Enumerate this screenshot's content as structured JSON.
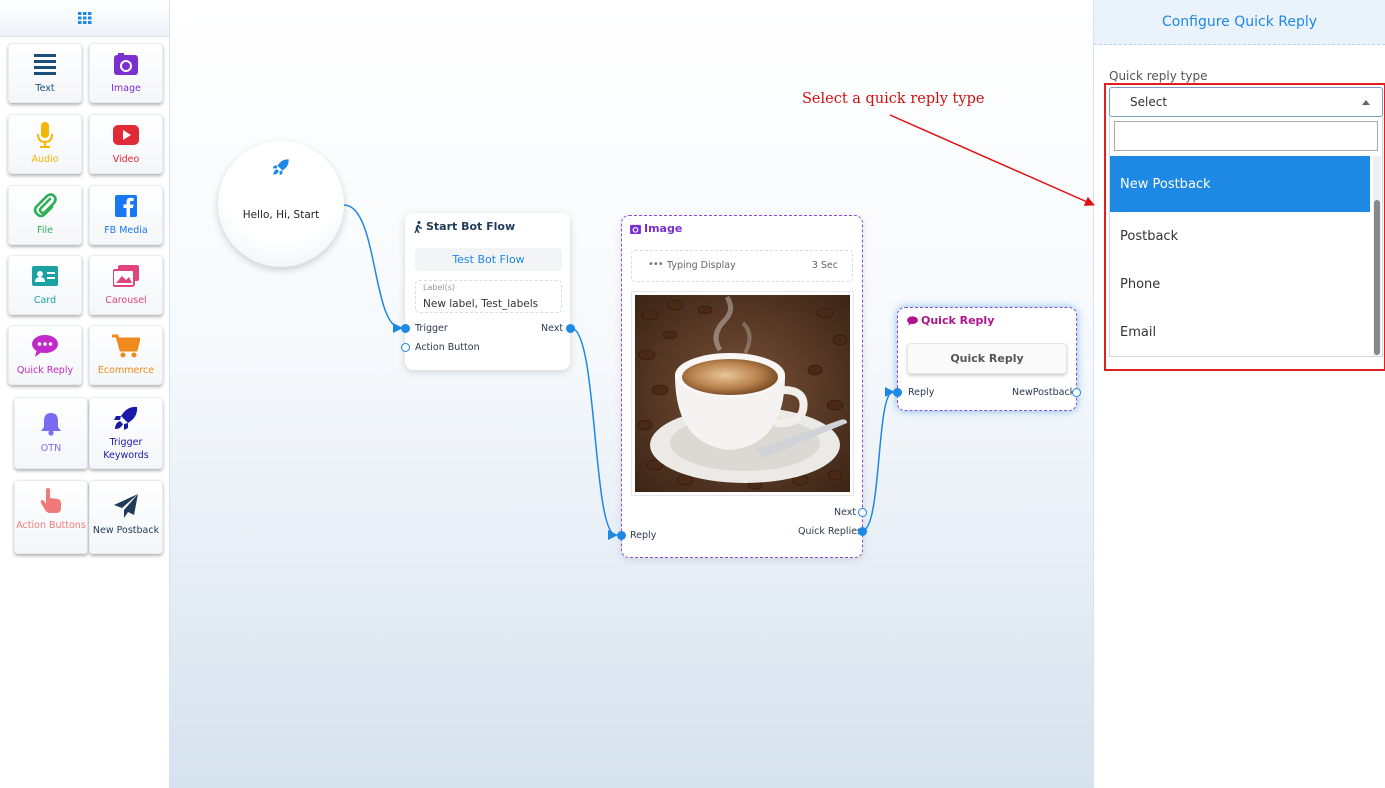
{
  "sidebar": {
    "tiles": [
      {
        "label": "Text",
        "icon": "text-lines-icon",
        "color": "#1b4f7a"
      },
      {
        "label": "Image",
        "icon": "image-icon",
        "color": "#7b2fd0"
      },
      {
        "label": "Audio",
        "icon": "microphone-icon",
        "color": "#f2b705"
      },
      {
        "label": "Video",
        "icon": "youtube-icon",
        "color": "#e02a36"
      },
      {
        "label": "File",
        "icon": "paperclip-icon",
        "color": "#2eae55"
      },
      {
        "label": "FB Media",
        "icon": "facebook-icon",
        "color": "#1877f2"
      },
      {
        "label": "Card",
        "icon": "id-card-icon",
        "color": "#1aa2a2"
      },
      {
        "label": "Carousel",
        "icon": "images-icon",
        "color": "#e0457b"
      },
      {
        "label": "Quick Reply",
        "icon": "chat-bubble-icon",
        "color": "#c02ac8"
      },
      {
        "label": "Ecommerce",
        "icon": "cart-icon",
        "color": "#f08a1c"
      },
      {
        "label": "OTN",
        "icon": "bell-icon",
        "color": "#7a6cf0"
      },
      {
        "label": "Trigger Keywords",
        "icon": "rocket-icon",
        "color": "#1a1aa8"
      },
      {
        "label": "Action Buttons",
        "icon": "pointer-hand-icon",
        "color": "#f07a7a"
      },
      {
        "label": "New Postback",
        "icon": "paper-plane-icon",
        "color": "#1f3b57"
      }
    ]
  },
  "canvas": {
    "start_node": {
      "text": "Hello, Hi, Start",
      "icon": "rocket-icon"
    },
    "bot_flow_node": {
      "title": "Start Bot Flow",
      "icon": "walking-person-icon",
      "button": "Test Bot Flow",
      "labels_caption": "Label(s)",
      "labels_value": "New label, Test_labels",
      "port_trigger": "Trigger",
      "port_next": "Next",
      "port_action": "Action Button"
    },
    "image_node": {
      "title": "Image",
      "icon": "image-icon",
      "typing_label": "Typing Display",
      "typing_value": "3 Sec",
      "port_reply": "Reply",
      "port_next": "Next",
      "port_quick": "Quick Replies"
    },
    "quick_reply_node": {
      "title": "Quick Reply",
      "icon": "chat-bubble-icon",
      "button": "Quick Reply",
      "port_reply": "Reply",
      "port_postback": "NewPostback"
    }
  },
  "annotation": "Select a quick reply type",
  "panel": {
    "title": "Configure Quick Reply",
    "field_label": "Quick reply type",
    "select_value": "Select",
    "search_value": "",
    "options": [
      "New Postback",
      "Postback",
      "Phone",
      "Email"
    ],
    "active_option": "New Postback"
  },
  "colors": {
    "accent": "#1e88e5",
    "annotation": "#d01010",
    "quick_reply_purple": "#b0128f"
  }
}
